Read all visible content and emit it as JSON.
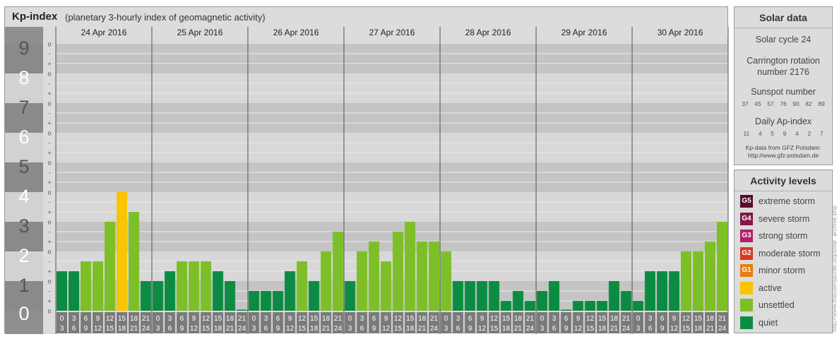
{
  "header": {
    "title": "Kp-index",
    "subtitle": "(planetary 3-hourly index of geomagnetic activity)"
  },
  "chart_data": {
    "type": "bar",
    "y_axis": {
      "min": 0,
      "max": 9,
      "major_labels": [
        "0",
        "1",
        "2",
        "3",
        "4",
        "5",
        "6",
        "7",
        "8",
        "9"
      ],
      "minor_symbols": [
        "o",
        "+",
        "-",
        "o",
        "+",
        "-",
        "o",
        "+",
        "-",
        "o",
        "+",
        "-",
        "o",
        "+",
        "-",
        "o",
        "+",
        "-",
        "o",
        "+",
        "-",
        "o",
        "+",
        "-",
        "o",
        "+",
        "-",
        "o"
      ]
    },
    "interval_labels": [
      [
        "0",
        "3"
      ],
      [
        "3",
        "6"
      ],
      [
        "6",
        "9"
      ],
      [
        "9",
        "12"
      ],
      [
        "12",
        "15"
      ],
      [
        "15",
        "18"
      ],
      [
        "18",
        "21"
      ],
      [
        "21",
        "24"
      ]
    ],
    "days": [
      {
        "date": "24 Apr 2016",
        "kp": [
          1.333,
          1.333,
          1.667,
          1.667,
          3.0,
          4.0,
          3.333,
          1.0
        ]
      },
      {
        "date": "25 Apr 2016",
        "kp": [
          1.0,
          1.333,
          1.667,
          1.667,
          1.667,
          1.333,
          1.0,
          0.0
        ]
      },
      {
        "date": "26 Apr 2016",
        "kp": [
          0.667,
          0.667,
          0.667,
          1.333,
          1.667,
          1.0,
          2.0,
          2.667
        ]
      },
      {
        "date": "27 Apr 2016",
        "kp": [
          1.0,
          2.0,
          2.333,
          1.667,
          2.667,
          3.0,
          2.333,
          2.333
        ]
      },
      {
        "date": "28 Apr 2016",
        "kp": [
          2.0,
          1.0,
          1.0,
          1.0,
          1.0,
          0.333,
          0.667,
          0.333
        ]
      },
      {
        "date": "29 Apr 2016",
        "kp": [
          0.667,
          1.0,
          0.0,
          0.333,
          0.333,
          0.333,
          1.0,
          0.667
        ]
      },
      {
        "date": "30 Apr 2016",
        "kp": [
          0.333,
          1.333,
          1.333,
          1.333,
          2.0,
          2.0,
          2.333,
          3.0
        ]
      }
    ],
    "colors": {
      "quiet": "#0c8c43",
      "unsettled": "#7dbf26",
      "active": "#f9c400",
      "grid_dark": "#c4c4c4",
      "grid_light": "#d8d8d8",
      "axis_bg": "#8f8f8f",
      "interval_bg": "#7a7a7a"
    }
  },
  "solar": {
    "title": "Solar data",
    "cycle": "Solar cycle 24",
    "carrington_line1": "Carrington rotation",
    "carrington_line2": "number 2176",
    "sunspot_label": "Sunspot number",
    "sunspot_values": [
      "37",
      "45",
      "57",
      "76",
      "90",
      "82",
      "89"
    ],
    "ap_label": "Daily Ap-index",
    "ap_values": [
      "11",
      "4",
      "5",
      "9",
      "4",
      "2",
      "7"
    ],
    "source_line1": "Kp-data from GFZ Potsdam:",
    "source_line2": "http://www.gfz-potsdam.de"
  },
  "activity": {
    "title": "Activity levels",
    "levels": [
      {
        "badge": "G5",
        "label": "extreme storm",
        "color": "#5a0a2e"
      },
      {
        "badge": "G4",
        "label": "severe storm",
        "color": "#861548"
      },
      {
        "badge": "G3",
        "label": "strong storm",
        "color": "#b51f6b"
      },
      {
        "badge": "G2",
        "label": "moderate storm",
        "color": "#d7391e"
      },
      {
        "badge": "G1",
        "label": "minor storm",
        "color": "#e47d12"
      },
      {
        "badge": "",
        "label": "active",
        "color": "#f9c400"
      },
      {
        "badge": "",
        "label": "unsettled",
        "color": "#7dbf26"
      },
      {
        "badge": "",
        "label": "quiet",
        "color": "#0c8c43"
      }
    ]
  },
  "watermark": "http://www.theusersguide.org/solar_archive.php"
}
